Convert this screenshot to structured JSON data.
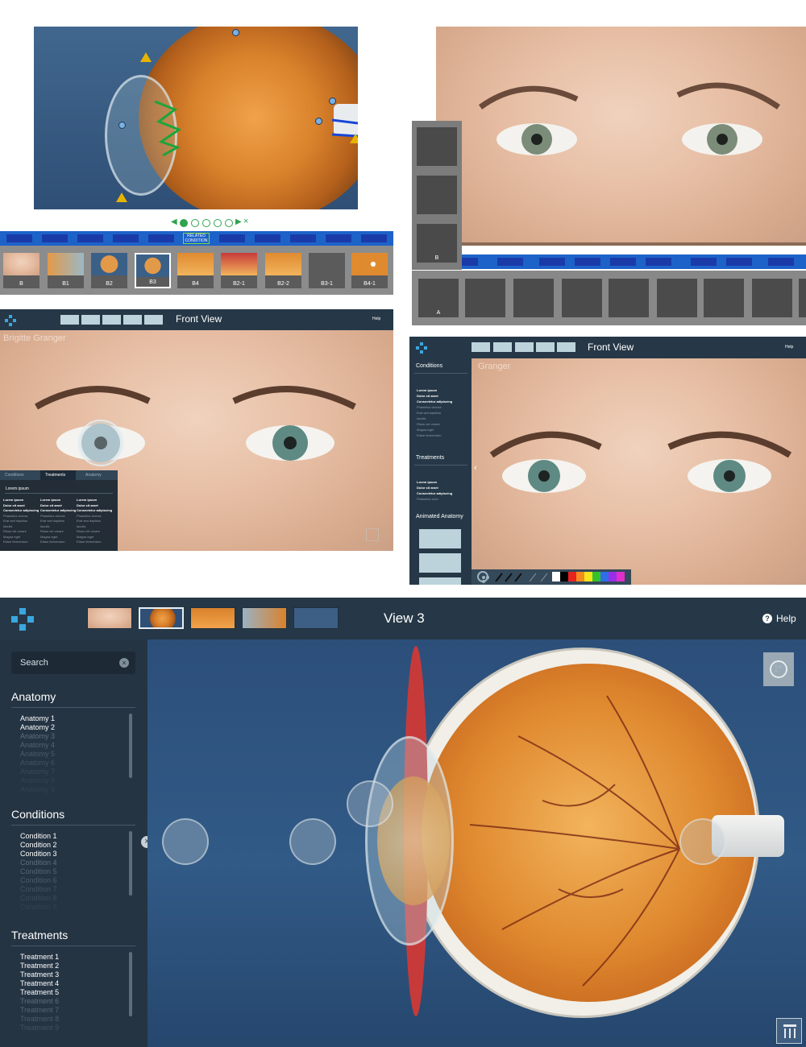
{
  "panel1": {
    "related_label": "RELATED CONDITION",
    "pager_prev": "◀",
    "pager_next": "▶",
    "pager_close": "×",
    "thumbs": [
      "B",
      "B1",
      "B2",
      "B3",
      "B4",
      "B2-1",
      "B2-2",
      "B3-1",
      "B4-1"
    ],
    "selected_thumb": "B3"
  },
  "panel2": {
    "side_labels": [
      "B"
    ],
    "bottom_label": "A"
  },
  "panel3": {
    "title": "Front View",
    "help": "Help",
    "watermark": "Brigitte Granger",
    "tabs": [
      "Conditions",
      "Treatments",
      "Anatomy"
    ],
    "active_tab": "Treatments",
    "menu_header": "Lorem ipsum",
    "columns": [
      [
        "Lorem ipsum",
        "Dolor sit amet",
        "Consectetur adipiscing",
        "Phasellus viverra",
        "Erat sed dapibus",
        "Iaculis",
        "Risus vel ornare",
        "Magna eget",
        "Etiam fermentum"
      ],
      [
        "Lorem ipsum",
        "Dolor sit amet",
        "Consectetur adipiscing",
        "Phasellus viverra",
        "Erat sed dapibus",
        "Iaculis",
        "Risus vel ornare",
        "Magna eget",
        "Etiam fermentum"
      ],
      [
        "Lorem ipsum",
        "Dolor sit amet",
        "Consectetur adipiscing",
        "Phasellus viverra",
        "Erat sed dapibus",
        "Iaculis",
        "Risus vel ornare",
        "Magna eget",
        "Etiam fermentum"
      ]
    ]
  },
  "panel4": {
    "title": "Front View",
    "help": "Help",
    "watermark": "Granger",
    "conditions_title": "Conditions",
    "conditions": [
      "Lorem ipsum",
      "Dolor sit amet",
      "Consectetur adipiscing",
      "Phasellus viverra",
      "Erat sed dapibus",
      "Iaculis",
      "Risus vel ornare",
      "Magna eget",
      "Etiam fermentum"
    ],
    "treatments_title": "Treatments",
    "treatments": [
      "Lorem ipsum",
      "Dolor sit amet",
      "Consectetur adipiscing",
      "Phasellus viver"
    ],
    "animated_title": "Animated Anatomy",
    "swatches": [
      "#ffffff",
      "#000000",
      "#e8231f",
      "#f58a1f",
      "#f6e51b",
      "#35c22d",
      "#2e6fe8",
      "#9a2ee8",
      "#e02ec9"
    ]
  },
  "main": {
    "title": "View 3",
    "help": "Help",
    "search_placeholder": "Search",
    "anatomy_title": "Anatomy",
    "anatomy": [
      "Anatomy 1",
      "Anatomy 2",
      "Anatomy 3",
      "Anatomy 4",
      "Anatomy 5",
      "Anatomy 6",
      "Anatomy 7",
      "Anatomy 8",
      "Anatomy 9"
    ],
    "conditions_title": "Conditions",
    "conditions": [
      "Condition 1",
      "Condition 2",
      "Condition 3",
      "Condition 4",
      "Condition 5",
      "Condition 6",
      "Condition 7",
      "Condition 8",
      "Condition 9"
    ],
    "treatments_title": "Treatments",
    "treatments": [
      "Treatment 1",
      "Treatment 2",
      "Treatment 3",
      "Treatment 4",
      "Treatment 5",
      "Treatment 6",
      "Treatment 7",
      "Treatment 8",
      "Treatment 9"
    ],
    "visible_counts": {
      "anatomy": 2,
      "conditions": 3,
      "treatments": 5
    }
  },
  "colors": {
    "accent": "#3aa7e0",
    "bar": "#263847",
    "green": "#2ea44f",
    "strip_blue": "#1d62c9"
  },
  "icons": [
    "help-icon",
    "palette-icon",
    "clear-icon",
    "close-icon",
    "collapse-icon",
    "logo-icon"
  ]
}
